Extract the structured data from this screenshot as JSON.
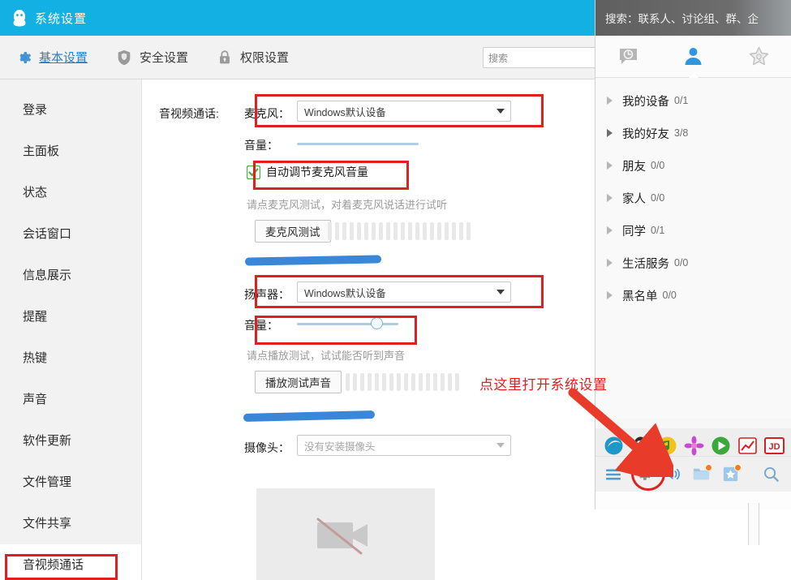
{
  "settings_window": {
    "title": "系统设置",
    "logo_icon": "qq-penguin-icon",
    "tabs": [
      {
        "label": "基本设置",
        "icon": "gear-icon",
        "active": true
      },
      {
        "label": "安全设置",
        "icon": "shield-icon",
        "active": false
      },
      {
        "label": "权限设置",
        "icon": "lock-icon",
        "active": false
      }
    ],
    "search": {
      "placeholder": "搜索",
      "value": "搜索"
    },
    "sidebar": {
      "items": [
        {
          "label": "登录",
          "selected": false
        },
        {
          "label": "主面板",
          "selected": false
        },
        {
          "label": "状态",
          "selected": false
        },
        {
          "label": "会话窗口",
          "selected": false
        },
        {
          "label": "信息展示",
          "selected": false
        },
        {
          "label": "提醒",
          "selected": false
        },
        {
          "label": "热键",
          "selected": false
        },
        {
          "label": "声音",
          "selected": false
        },
        {
          "label": "软件更新",
          "selected": false
        },
        {
          "label": "文件管理",
          "selected": false
        },
        {
          "label": "文件共享",
          "selected": false
        },
        {
          "label": "音视频通话",
          "selected": true
        }
      ]
    },
    "content": {
      "section_label": "音视频通话:",
      "microphone": {
        "label": "麦克风：",
        "device_value": "Windows默认设备",
        "volume_label": "音量：",
        "volume_percent": 0,
        "auto_gain_label": "自动调节麦克风音量",
        "auto_gain_checked": true,
        "hint": "请点麦克风测试，对着麦克风说话进行试听",
        "test_button": "麦克风测试"
      },
      "speaker": {
        "label": "扬声器：",
        "device_value": "Windows默认设备",
        "volume_label": "音量：",
        "volume_percent": 78,
        "hint": "请点播放测试，试试能否听到声音",
        "test_button": "播放测试声音"
      },
      "camera": {
        "label": "摄像头：",
        "device_value": "没有安装摄像头",
        "preview_icon": "camera-disabled-icon"
      }
    }
  },
  "annotation": {
    "text": "点这里打开系统设置",
    "color": "#e02020",
    "arrow_icon": "arrow-icon",
    "marker_color": "#2f80d6"
  },
  "qq_panel": {
    "search_placeholder": "搜索：联系人、讨论组、群、企",
    "tabs": [
      {
        "icon": "message-bubble-icon",
        "label": "消息",
        "active": false
      },
      {
        "icon": "contacts-person-icon",
        "label": "联系人",
        "active": true
      },
      {
        "icon": "group-star-icon",
        "label": "群聊",
        "active": false
      }
    ],
    "groups": [
      {
        "name": "我的设备",
        "count": "0/1"
      },
      {
        "name": "我的好友",
        "count": "3/8"
      },
      {
        "name": "朋友",
        "count": "0/0"
      },
      {
        "name": "家人",
        "count": "0/0"
      },
      {
        "name": "同学",
        "count": "0/1"
      },
      {
        "name": "生活服务",
        "count": "0/0"
      },
      {
        "name": "黑名单",
        "count": "0/0"
      }
    ],
    "app_icons": [
      {
        "name": "browser-icon",
        "color": "#2196c9"
      },
      {
        "name": "qq-penguin-app-icon",
        "color": "#2b7fc2"
      },
      {
        "name": "qq-music-icon",
        "color": "#f2c21b"
      },
      {
        "name": "flower-app-icon",
        "color": "#c64bd0"
      },
      {
        "name": "video-player-icon",
        "color": "#3aa83a"
      },
      {
        "name": "stock-app-icon",
        "color": "#d32020"
      },
      {
        "name": "jd-shop-icon",
        "color": "#d32020"
      }
    ],
    "toolbar_icons": [
      {
        "name": "hamburger-menu-icon",
        "badge": false
      },
      {
        "name": "gear-icon",
        "badge": false,
        "highlighted": true
      },
      {
        "name": "speaker-icon",
        "badge": false
      },
      {
        "name": "folder-icon",
        "badge": true
      },
      {
        "name": "bookmark-star-icon",
        "badge": true
      },
      {
        "name": "search-icon",
        "badge": false
      }
    ]
  }
}
